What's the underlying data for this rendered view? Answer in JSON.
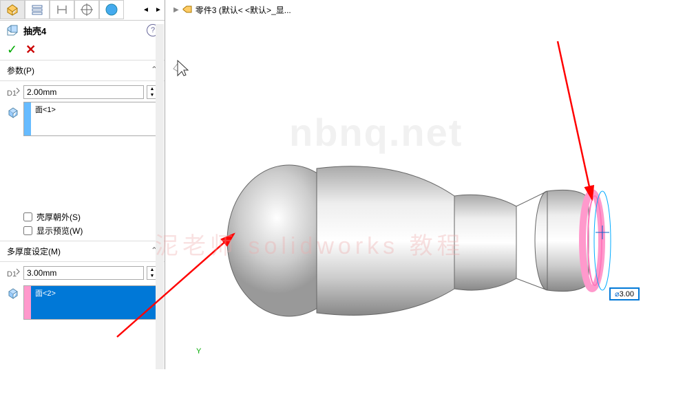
{
  "tabs": {
    "arrows": [
      "◄",
      "►"
    ]
  },
  "feature": {
    "name": "抽壳4",
    "help": "?"
  },
  "confirm": {
    "ok": "✓",
    "cancel": "✕"
  },
  "params": {
    "header": "参数(P)",
    "d1_value": "2.00mm",
    "face_item": "面<1>",
    "checkbox1": "壳厚朝外(S)",
    "checkbox2": "显示预览(W)"
  },
  "multi": {
    "header": "多厚度设定(M)",
    "d1_value": "3.00mm",
    "face_item": "面<2>"
  },
  "breadcrumb": {
    "part": "零件3  (默认< <默认>_显..."
  },
  "viewport": {
    "dim_value": "3.00",
    "origin": "Y",
    "watermark1": "nbnq.net",
    "watermark2": "泥老师 solidworks 教程"
  }
}
